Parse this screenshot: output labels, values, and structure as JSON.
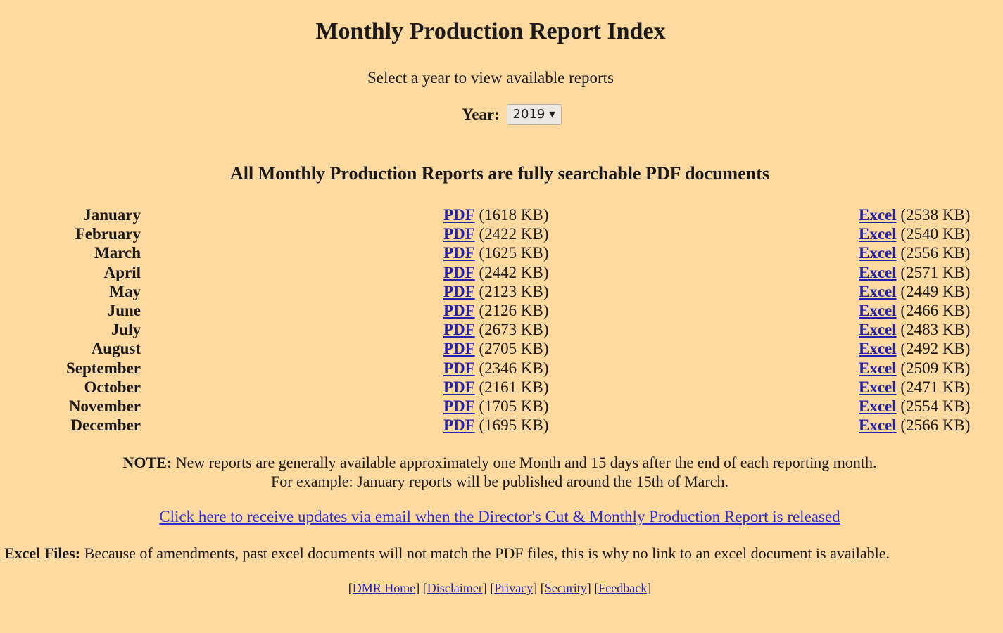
{
  "header": {
    "title": "Monthly Production Report Index",
    "subtitle": "Select a year to view available reports"
  },
  "year_selector": {
    "label": "Year:",
    "selected": "2019"
  },
  "section_heading": "All Monthly Production Reports are fully searchable PDF documents",
  "reports": [
    {
      "month": "January",
      "pdf_label": "PDF",
      "pdf_size": "(1618 KB)",
      "excel_label": "Excel",
      "excel_size": "(2538 KB)"
    },
    {
      "month": "February",
      "pdf_label": "PDF",
      "pdf_size": "(2422 KB)",
      "excel_label": "Excel",
      "excel_size": "(2540 KB)"
    },
    {
      "month": "March",
      "pdf_label": "PDF",
      "pdf_size": "(1625 KB)",
      "excel_label": "Excel",
      "excel_size": "(2556 KB)"
    },
    {
      "month": "April",
      "pdf_label": "PDF",
      "pdf_size": "(2442 KB)",
      "excel_label": "Excel",
      "excel_size": "(2571 KB)"
    },
    {
      "month": "May",
      "pdf_label": "PDF",
      "pdf_size": "(2123 KB)",
      "excel_label": "Excel",
      "excel_size": "(2449 KB)"
    },
    {
      "month": "June",
      "pdf_label": "PDF",
      "pdf_size": "(2126 KB)",
      "excel_label": "Excel",
      "excel_size": "(2466 KB)"
    },
    {
      "month": "July",
      "pdf_label": "PDF",
      "pdf_size": "(2673 KB)",
      "excel_label": "Excel",
      "excel_size": "(2483 KB)"
    },
    {
      "month": "August",
      "pdf_label": "PDF",
      "pdf_size": "(2705 KB)",
      "excel_label": "Excel",
      "excel_size": "(2492 KB)"
    },
    {
      "month": "September",
      "pdf_label": "PDF",
      "pdf_size": "(2346 KB)",
      "excel_label": "Excel",
      "excel_size": "(2509 KB)"
    },
    {
      "month": "October",
      "pdf_label": "PDF",
      "pdf_size": "(2161 KB)",
      "excel_label": "Excel",
      "excel_size": "(2471 KB)"
    },
    {
      "month": "November",
      "pdf_label": "PDF",
      "pdf_size": "(1705 KB)",
      "excel_label": "Excel",
      "excel_size": "(2554 KB)"
    },
    {
      "month": "December",
      "pdf_label": "PDF",
      "pdf_size": "(1695 KB)",
      "excel_label": "Excel",
      "excel_size": "(2566 KB)"
    }
  ],
  "note": {
    "label": "NOTE:",
    "line1": "New reports are generally available approximately one Month and 15 days after the end of each reporting month.",
    "line2": "For example: January reports will be published around the 15th of March."
  },
  "updates_link": "Click here to receive updates via email when the Director's Cut & Monthly Production Report is released",
  "excel_note": {
    "label": "Excel Files:",
    "text": "Because of amendments, past excel documents will not match the PDF files, this is why no link to an excel document is available."
  },
  "footer": {
    "links": [
      "DMR Home",
      "Disclaimer",
      "Privacy",
      "Security",
      "Feedback"
    ]
  },
  "colors": {
    "background": "#fedaa1",
    "link": "#2323a8"
  }
}
